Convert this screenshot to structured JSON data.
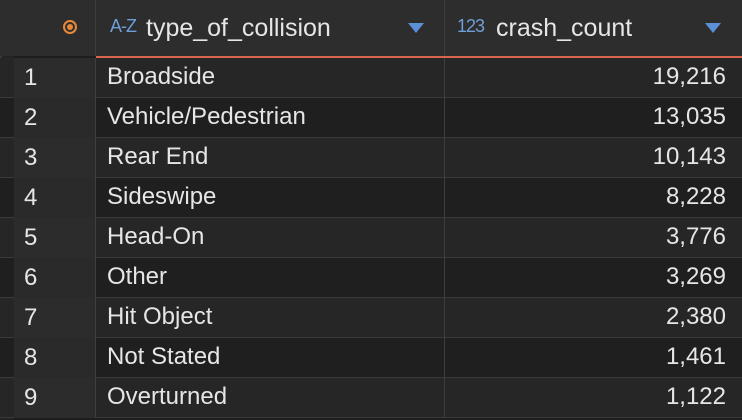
{
  "header": {
    "col1": {
      "type_icon": "A-Z",
      "label": "type_of_collision"
    },
    "col2": {
      "type_icon": "123",
      "label": "crash_count"
    }
  },
  "rows": [
    {
      "num": "1",
      "type": "Broadside",
      "count": "19,216"
    },
    {
      "num": "2",
      "type": "Vehicle/Pedestrian",
      "count": "13,035"
    },
    {
      "num": "3",
      "type": "Rear End",
      "count": "10,143"
    },
    {
      "num": "4",
      "type": "Sideswipe",
      "count": "8,228"
    },
    {
      "num": "5",
      "type": "Head-On",
      "count": "3,776"
    },
    {
      "num": "6",
      "type": "Other",
      "count": "3,269"
    },
    {
      "num": "7",
      "type": "Hit Object",
      "count": "2,380"
    },
    {
      "num": "8",
      "type": "Not Stated",
      "count": "1,461"
    },
    {
      "num": "9",
      "type": "Overturned",
      "count": "1,122"
    }
  ],
  "colors": {
    "accent": "#d9644f",
    "corner_icon": "#e8893a",
    "type_icon": "#6f9fd8",
    "sort_arrow": "#5b8fd6"
  },
  "icons": {
    "corner": "record-circle-icon",
    "sort": "chevron-down-icon"
  }
}
